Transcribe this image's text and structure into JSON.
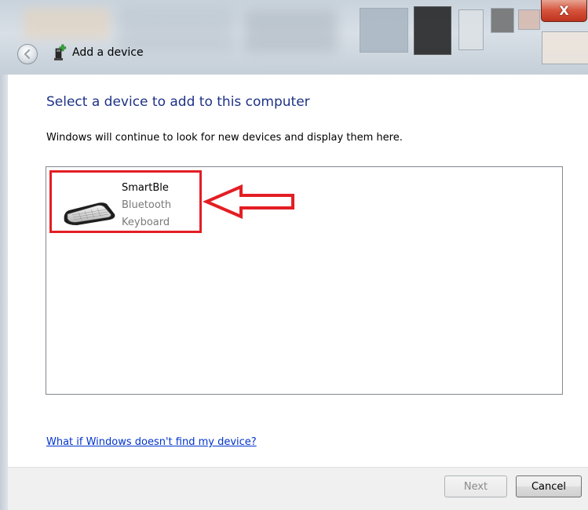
{
  "window": {
    "title": "Add a device",
    "close_label": "X"
  },
  "main": {
    "heading": "Select a device to add to this computer",
    "subtitle": "Windows will continue to look for new devices and display them here.",
    "devices": [
      {
        "name": "SmartBle",
        "type_line1": "Bluetooth",
        "type_line2": "Keyboard",
        "icon": "keyboard-icon"
      }
    ],
    "help_link": "What if Windows doesn't find my device?"
  },
  "footer": {
    "next_label": "Next",
    "cancel_label": "Cancel"
  },
  "colors": {
    "heading": "#1e3287",
    "link": "#0033cc",
    "highlight_annotation": "#e31e24"
  }
}
